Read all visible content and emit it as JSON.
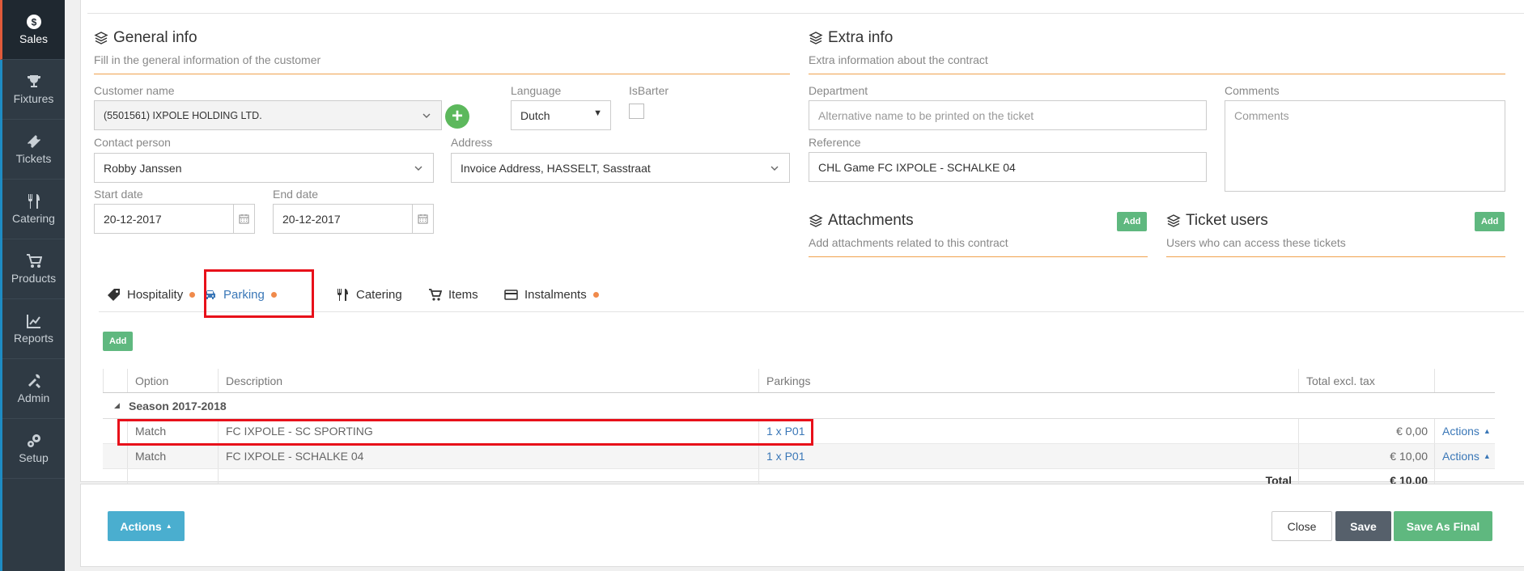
{
  "sidebar": {
    "items": [
      {
        "label": "Sales",
        "icon": "dollar-icon",
        "active": true
      },
      {
        "label": "Fixtures",
        "icon": "trophy-icon"
      },
      {
        "label": "Tickets",
        "icon": "ticket-icon"
      },
      {
        "label": "Catering",
        "icon": "cutlery-icon"
      },
      {
        "label": "Products",
        "icon": "cart-icon"
      },
      {
        "label": "Reports",
        "icon": "chart-icon"
      },
      {
        "label": "Admin",
        "icon": "tools-icon"
      },
      {
        "label": "Setup",
        "icon": "gears-icon"
      }
    ]
  },
  "general": {
    "title": "General info",
    "subtitle": "Fill in the general information of the customer",
    "customer_label": "Customer name",
    "customer_value": "(5501561) IXPOLE HOLDING LTD.",
    "language_label": "Language",
    "language_value": "Dutch",
    "isbarter_label": "IsBarter",
    "contact_label": "Contact person",
    "contact_value": "Robby Janssen",
    "address_label": "Address",
    "address_value": "Invoice Address, HASSELT, Sasstraat",
    "start_label": "Start date",
    "start_value": "20-12-2017",
    "end_label": "End date",
    "end_value": "20-12-2017"
  },
  "extra": {
    "title": "Extra info",
    "subtitle": "Extra information about the contract",
    "department_label": "Department",
    "department_placeholder": "Alternative name to be printed on the ticket",
    "comments_label": "Comments",
    "comments_placeholder": "Comments",
    "reference_label": "Reference",
    "reference_value": "CHL Game FC IXPOLE - SCHALKE 04"
  },
  "attachments": {
    "title": "Attachments",
    "subtitle": "Add attachments related to this contract",
    "add_label": "Add"
  },
  "ticket_users": {
    "title": "Ticket users",
    "subtitle": "Users who can access these tickets",
    "add_label": "Add"
  },
  "tabs": [
    {
      "label": "Hospitality",
      "icon": "tag-icon",
      "dot": true
    },
    {
      "label": "Parking",
      "icon": "car-icon",
      "dot": true,
      "active": true
    },
    {
      "label": "Catering",
      "icon": "cutlery-icon",
      "dot": false
    },
    {
      "label": "Items",
      "icon": "cart-icon",
      "dot": false
    },
    {
      "label": "Instalments",
      "icon": "credit-card-icon",
      "dot": true
    }
  ],
  "table": {
    "add_label": "Add",
    "headers": {
      "option": "Option",
      "description": "Description",
      "parkings": "Parkings",
      "total": "Total excl. tax"
    },
    "group": "Season 2017-2018",
    "rows": [
      {
        "option": "Match",
        "description": "FC IXPOLE - SC SPORTING",
        "parkings": "1 x P01",
        "total": "€ 0,00",
        "actions": "Actions"
      },
      {
        "option": "Match",
        "description": "FC IXPOLE - SCHALKE 04",
        "parkings": "1 x P01",
        "total": "€ 10,00",
        "actions": "Actions"
      }
    ],
    "total_label": "Total",
    "total_value": "€ 10,00"
  },
  "footer": {
    "actions_label": "Actions",
    "close_label": "Close",
    "save_label": "Save",
    "save_final_label": "Save As Final"
  },
  "colors": {
    "accent": "#3a77b7",
    "highlight": "#e8101a",
    "success": "#5fb87f",
    "sidebar": "#2f3a44",
    "orange": "#f0a24e"
  }
}
